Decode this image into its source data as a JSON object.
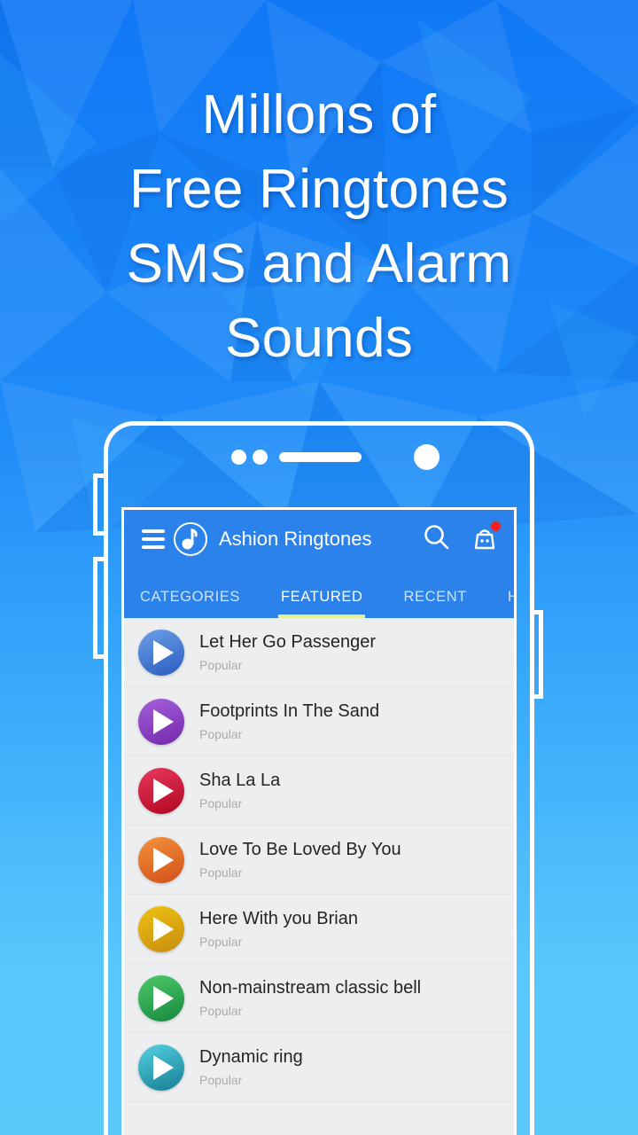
{
  "promo": {
    "headline_lines": [
      "Millons of",
      "Free Ringtones",
      "SMS and Alarm",
      "Sounds"
    ],
    "background_top_color": "#1078f5",
    "background_bottom_color": "#5cc9fb"
  },
  "phone": {
    "frame_color": "#ffffff",
    "parts": {
      "sensor_left": "sensor-dot-icon",
      "sensor_right": "sensor-dot-icon",
      "speaker": "earpiece-speaker",
      "camera": "front-camera-icon",
      "volume_up": "volume-up-button",
      "volume_down": "volume-down-button",
      "power": "power-button"
    }
  },
  "app": {
    "accent_color": "#2a82ea",
    "appbar": {
      "menu_icon": "hamburger-menu-icon",
      "logo_icon": "music-note-logo-icon",
      "title": "Ashion Ringtones",
      "search_icon": "search-icon",
      "gift_icon": "gift-bag-icon",
      "badge_color": "#f42020",
      "badge_visible": true
    },
    "tabs": [
      {
        "label": "CATEGORIES",
        "active": false
      },
      {
        "label": "FEATURED",
        "active": true
      },
      {
        "label": "RECENT",
        "active": false
      },
      {
        "label": "HOT",
        "active": false,
        "truncated": "HO"
      }
    ],
    "tab_indicator_color": "#e2f09c",
    "list": {
      "items": [
        {
          "title": "Let Her Go Passenger",
          "subtitle": "Popular",
          "color_from": "#6d9fe8",
          "color_to": "#2a5cc0"
        },
        {
          "title": "Footprints In The Sand",
          "subtitle": "Popular",
          "color_from": "#a461dd",
          "color_to": "#7327aa"
        },
        {
          "title": "Sha La La",
          "subtitle": "Popular",
          "color_from": "#e8385e",
          "color_to": "#af0720"
        },
        {
          "title": "Love To Be Loved By You",
          "subtitle": "Popular",
          "color_from": "#f3933c",
          "color_to": "#d14e18"
        },
        {
          "title": "Here With you Brian",
          "subtitle": "Popular",
          "color_from": "#edc211",
          "color_to": "#c98c10"
        },
        {
          "title": "Non-mainstream classic bell",
          "subtitle": "Popular",
          "color_from": "#4ec96a",
          "color_to": "#15883c"
        },
        {
          "title": "Dynamic ring",
          "subtitle": "Popular",
          "color_from": "#54d2e0",
          "color_to": "#167d95"
        }
      ]
    }
  }
}
